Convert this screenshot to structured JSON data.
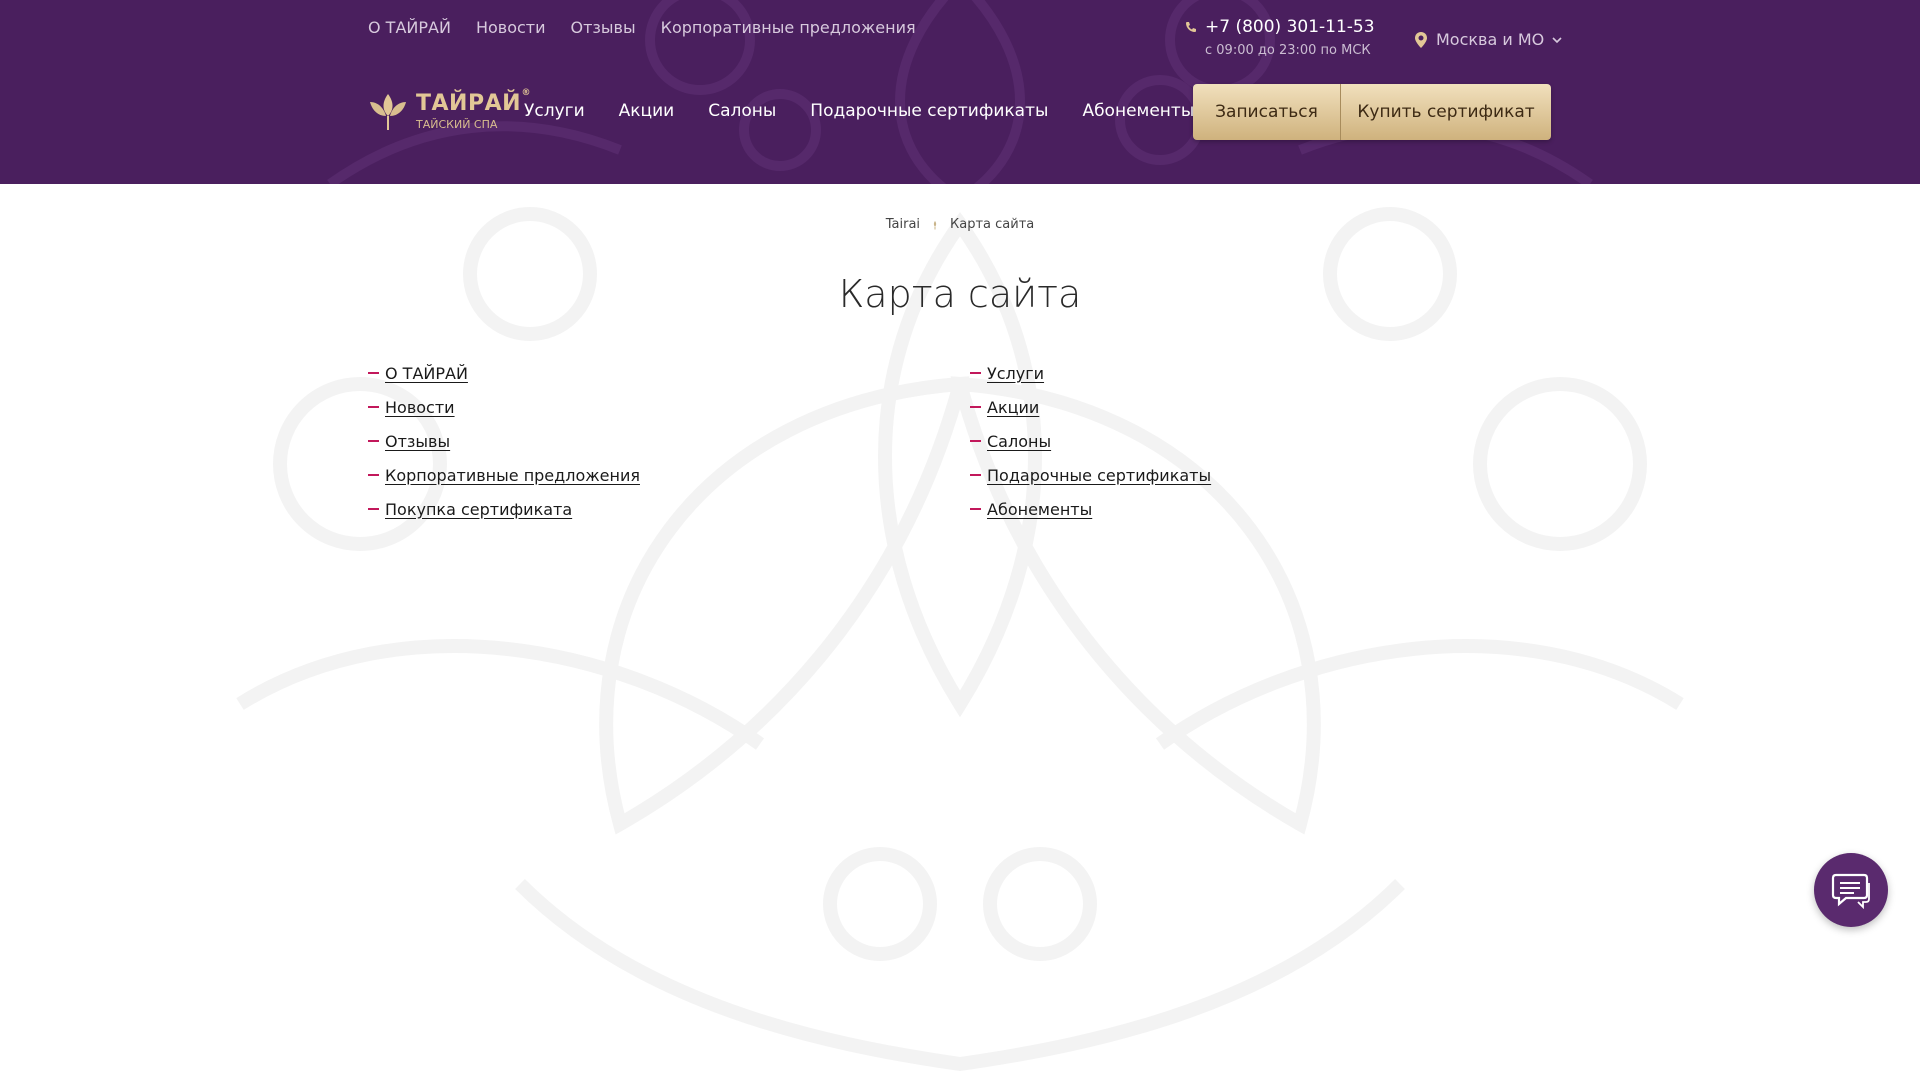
{
  "colors": {
    "header_bg": "#4a1f5e",
    "accent_gold": "#d9be8f",
    "dash": "#c2185b",
    "chat_bg": "#5a2a6e"
  },
  "topbar": {
    "links": [
      "О ТАЙРАЙ",
      "Новости",
      "Отзывы",
      "Корпоративные предложения"
    ],
    "phone": "+7 (800) 301-11-53",
    "hours": "с 09:00 до 23:00 по МСК",
    "city": "Москва и МО"
  },
  "logo": {
    "name": "ТАЙРАЙ",
    "sub": "ТАЙСКИЙ СПА",
    "reg": "®"
  },
  "nav": {
    "items": [
      "Услуги",
      "Акции",
      "Салоны",
      "Подарочные сертификаты",
      "Абонементы"
    ]
  },
  "buttons": {
    "book": "Записаться",
    "buy": "Купить сертификат"
  },
  "breadcrumb": {
    "home": "Tairai",
    "current": "Карта сайта"
  },
  "page": {
    "title": "Карта сайта"
  },
  "sitemap": {
    "left": [
      "О ТАЙРАЙ",
      "Новости",
      "Отзывы",
      "Корпоративные предложения",
      "Покупка сертификата"
    ],
    "right": [
      "Услуги",
      "Акции",
      "Салоны",
      "Подарочные сертификаты",
      "Абонементы"
    ]
  },
  "icons": {
    "phone": "phone-icon",
    "pin": "location-pin-icon",
    "chevron": "chevron-down-icon",
    "chat": "chat-icon",
    "logo": "lotus-leaf-icon"
  }
}
